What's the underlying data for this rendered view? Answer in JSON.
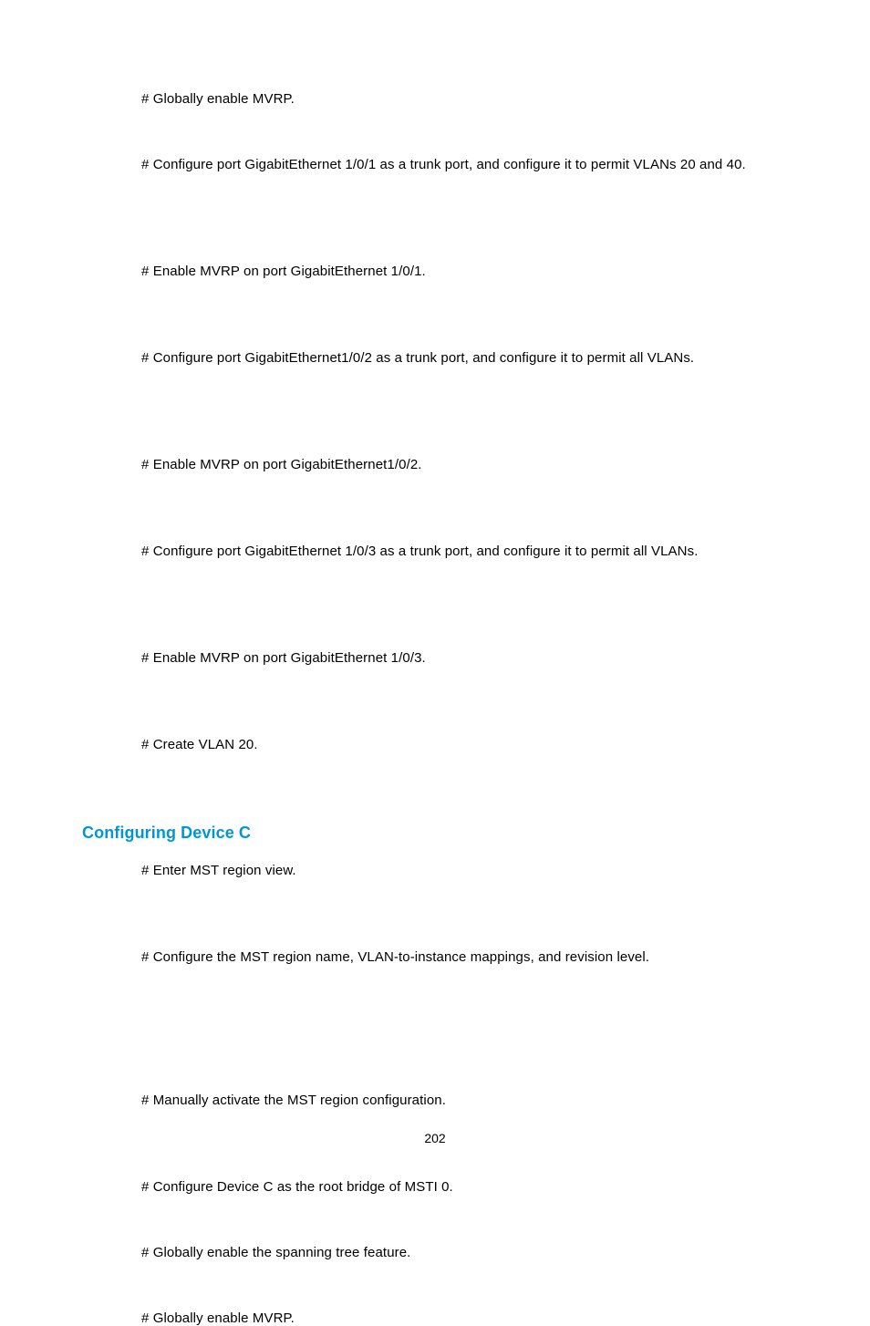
{
  "lines": {
    "l1": "# Globally enable MVRP.",
    "l2": "# Configure port GigabitEthernet 1/0/1 as a trunk port, and configure it to permit VLANs 20 and 40.",
    "l3": "# Enable MVRP on port GigabitEthernet 1/0/1.",
    "l4": "# Configure port GigabitEthernet1/0/2 as a trunk port, and configure it to permit all VLANs.",
    "l5": "# Enable MVRP on port GigabitEthernet1/0/2.",
    "l6": "# Configure port GigabitEthernet 1/0/3 as a trunk port, and configure it to permit all VLANs.",
    "l7": "# Enable MVRP on port GigabitEthernet 1/0/3.",
    "l8": "# Create VLAN 20.",
    "l9": "# Enter MST region view.",
    "l10": "# Configure the MST region name, VLAN-to-instance mappings, and revision level.",
    "l11": "# Manually activate the MST region configuration.",
    "l12": "# Configure Device C as the root bridge of MSTI 0.",
    "l13": "# Globally enable the spanning tree feature.",
    "l14": "# Globally enable MVRP."
  },
  "heading": "Configuring Device C",
  "pageNumber": "202"
}
